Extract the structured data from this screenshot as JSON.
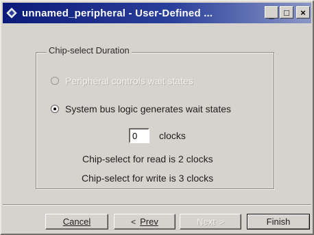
{
  "window": {
    "title": "unnamed_peripheral - User-Defined ..."
  },
  "titlebar": {
    "minimize_glyph": "_",
    "maximize_glyph": "□",
    "close_glyph": "×"
  },
  "group": {
    "legend": "Chip-select Duration"
  },
  "options": {
    "disabled_label": "Peripheral controls wait states",
    "enabled_label": "System bus logic generates wait states",
    "selected": "enabled"
  },
  "clocks": {
    "value": "0",
    "unit_label": "clocks"
  },
  "info": {
    "read": "Chip-select for read is 2 clocks",
    "write": "Chip-select for write is 3 clocks"
  },
  "buttons": {
    "cancel": "Cancel",
    "prev": "Prev",
    "prev_arrow": "<",
    "next": "Next",
    "next_arrow": ">",
    "finish": "Finish"
  }
}
